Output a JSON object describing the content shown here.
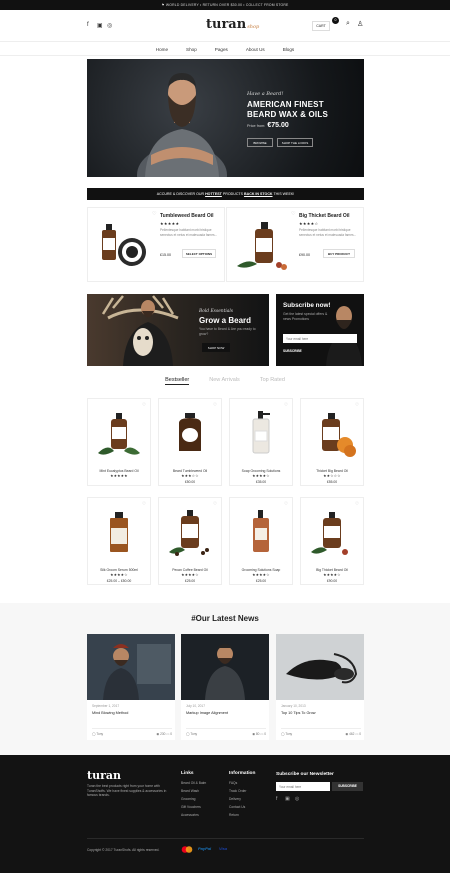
{
  "topbar": {
    "text": "⚑ WORLD DELIVERY • RETURN OVER $30.00 • COLLECT FROM STORE"
  },
  "header": {
    "logo": "turan",
    "logo_sub": "shop",
    "cart_label": "CART",
    "cart_count": "0"
  },
  "nav": [
    "Home",
    "Shop",
    "Pages",
    "About Us",
    "Blogs"
  ],
  "hero": {
    "script": "Have a Beard!",
    "title_line1": "AMERICAN FINEST",
    "title_line2": "BEARD WAX & OILS",
    "price_label": "Price from:",
    "price": "€75.00",
    "btn_browse": "BROWSE",
    "btn_shop": "SHOP THE LOOKS"
  },
  "promo": {
    "prefix": "ACCURE & DISCOVER OUR",
    "hot": "HOTTEST",
    "middle": "PRODUCTS",
    "back": "BACK IN STOCK",
    "suffix": "THIS WEEK!"
  },
  "featured": [
    {
      "name": "Tumbleweed Beard Oil",
      "stars": "★★★★★",
      "desc": "Pellentesque habitant morbi tristique senectus et netus et malesuada fames...",
      "price": "£15.00",
      "button": "SELECT OPTIONS"
    },
    {
      "name": "Big Thicket Beard Oil",
      "stars": "★★★★☆",
      "desc": "Pellentesque habitant morbi tristique senectus et netus et malesuada fames...",
      "price": "£90.00",
      "button": "BUY PRODUCT"
    }
  ],
  "banner_left": {
    "script": "Bold Essentials",
    "title": "Grow a Beard",
    "sub": "You have to Beard & Are you ready to grow?",
    "button": "SHOP NOW"
  },
  "banner_right": {
    "title": "Subscribe now!",
    "sub": "Get the latest special offers & news Promotions",
    "placeholder": "Your email here",
    "button": "SUBSCRIBE"
  },
  "tabs": [
    "Bestseller",
    "New Arrivals",
    "Top Rated"
  ],
  "products": [
    {
      "name": "Mint Eucalyptus Beard Oil",
      "stars": "★★★★★",
      "price": ""
    },
    {
      "name": "Beard Tumbleweed Oil",
      "stars": "★★★☆☆",
      "price": "£50.00"
    },
    {
      "name": "Soap Grooming Solutions",
      "stars": "★★★★☆",
      "price": "£35.00"
    },
    {
      "name": "Thicket Big Beard Oil",
      "stars": "★★☆☆☆",
      "price": "£55.00"
    },
    {
      "name": "Silk Groom Serum 500ml",
      "stars": "★★★★☆",
      "price": "£25.00 – £50.00"
    },
    {
      "name": "Pecan Coffee Beard Oil",
      "stars": "★★★★☆",
      "price": "£25.00"
    },
    {
      "name": "Grooming Solutions Soap",
      "stars": "★★★★☆",
      "price": "£25.00"
    },
    {
      "name": "Big Thicket Beard Oil",
      "stars": "★★★★☆",
      "price": "£90.00"
    }
  ],
  "news": {
    "title": "#Our Latest News",
    "items": [
      {
        "date": "September 1, 2017",
        "title": "Mind Blowing Method",
        "author": "Tony",
        "views": "230",
        "comments": "0"
      },
      {
        "date": "July 10, 2017",
        "title": "Markup Image Alignment",
        "author": "Tony",
        "views": "80",
        "comments": "0"
      },
      {
        "date": "January 10, 2013",
        "title": "Top 10 Tips To Grow",
        "author": "Tony",
        "views": "462",
        "comments": "0"
      }
    ]
  },
  "footer": {
    "logo": "turan",
    "about": "Turan the best products right from your home with TuranShoffs. We have finest supplies & accessories in famous brands.",
    "links_title": "Links",
    "links": [
      "Beard Oil & Balm",
      "Beard Wash",
      "Grooming",
      "Gift Vouchers",
      "Accessories"
    ],
    "info_title": "Information",
    "info": [
      "FAQs",
      "Track Order",
      "Delivery",
      "Contact Us",
      "Return"
    ],
    "newsletter_title": "Subscribe our Newsletter",
    "newsletter_placeholder": "Your email here",
    "newsletter_button": "SUBSCRIBE",
    "copyright": "Copyright © 2017 TuranShofs. All rights reserved.",
    "pay": [
      "PayPal",
      "Visa"
    ]
  }
}
